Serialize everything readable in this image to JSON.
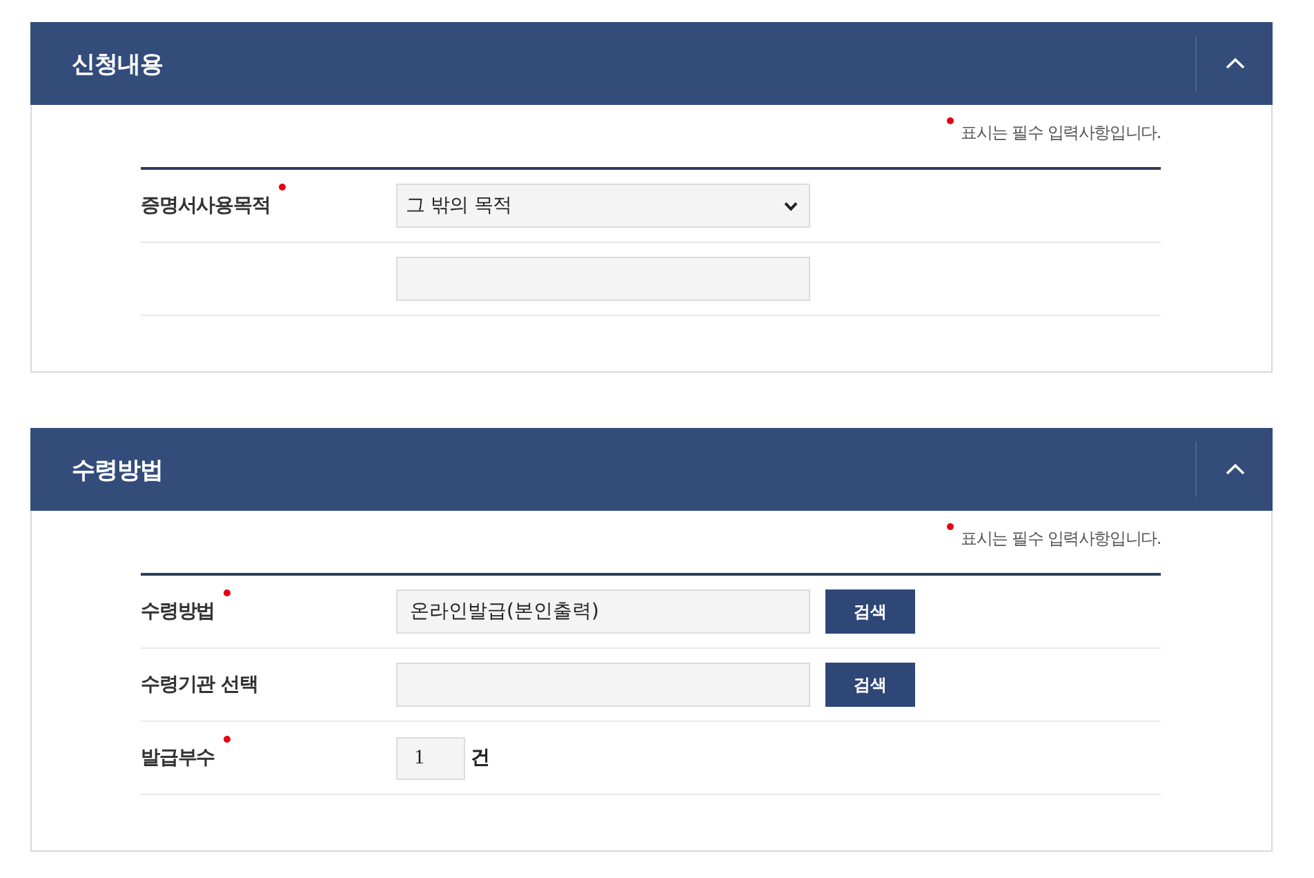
{
  "sections": [
    {
      "title": "신청내용",
      "expanded": true,
      "note": "표시는 필수 입력사항입니다.",
      "rows": [
        {
          "kind": "select",
          "label": "증명서사용목적",
          "required": true,
          "value": "그 밖의 목적"
        },
        {
          "kind": "text"
        }
      ]
    },
    {
      "title": "수령방법",
      "expanded": true,
      "note": "표시는 필수 입력사항입니다.",
      "rows": [
        {
          "kind": "search",
          "label": "수령방법",
          "required": true,
          "value": "온라인발급(본인출력)",
          "button": "검색"
        },
        {
          "kind": "search",
          "label": "수령기관 선택",
          "required": false,
          "button": "검색"
        },
        {
          "kind": "count",
          "label": "발급부수",
          "required": true,
          "value": "1",
          "unit": "건"
        }
      ]
    }
  ]
}
